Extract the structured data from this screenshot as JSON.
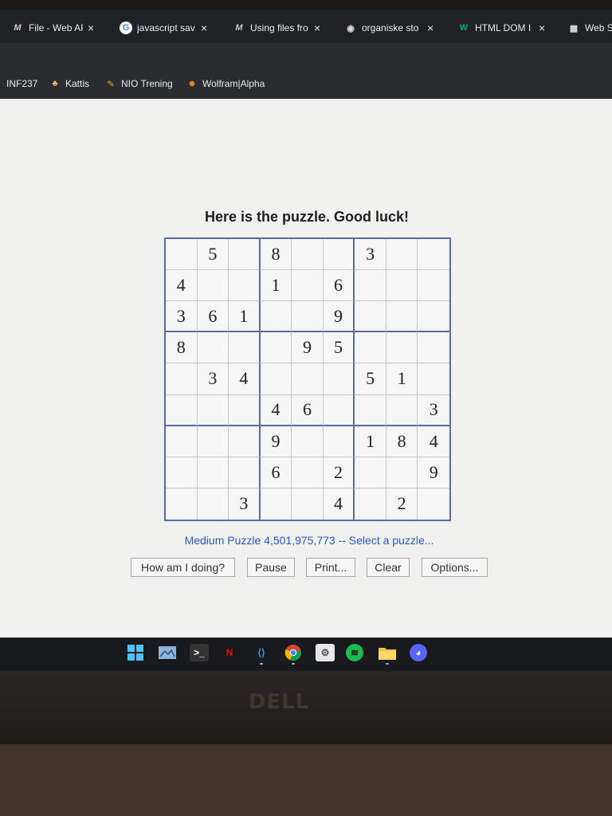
{
  "tabs": [
    {
      "icon": "mdn-m-icon",
      "glyph": "M",
      "title": "File - Web AP",
      "close": "×"
    },
    {
      "icon": "google-g-icon",
      "glyph": "G",
      "title": "javascript sav",
      "close": "×"
    },
    {
      "icon": "mdn-m-icon",
      "glyph": "M",
      "title": "Using files fro",
      "close": "×"
    },
    {
      "icon": "globe-icon",
      "glyph": "◉",
      "title": "organiske sto",
      "close": "×"
    },
    {
      "icon": "w3schools-icon",
      "glyph": "W",
      "title": "HTML DOM I",
      "close": "×"
    },
    {
      "icon": "grid-icon",
      "glyph": "▦",
      "title": "Web S",
      "close": ""
    }
  ],
  "bookmarks": [
    {
      "icon": "",
      "label": "INF237"
    },
    {
      "icon": "kattis-icon",
      "glyph": "♣",
      "label": "Kattis"
    },
    {
      "icon": "carrot-icon",
      "glyph": "✎",
      "label": "NIO Trening"
    },
    {
      "icon": "wolfram-icon",
      "glyph": "✹",
      "label": "Wolfram|Alpha"
    }
  ],
  "page": {
    "heading": "Here is the puzzle. Good luck!",
    "puzzle_name": "Medium Puzzle 4,501,975,773",
    "separator": " -- ",
    "select_link": "Select a puzzle...",
    "grid": [
      [
        "",
        "5",
        "",
        "8",
        "",
        "",
        "3",
        "",
        ""
      ],
      [
        "4",
        "",
        "",
        "1",
        "",
        "6",
        "",
        "",
        ""
      ],
      [
        "3",
        "6",
        "1",
        "",
        "",
        "9",
        "",
        "",
        ""
      ],
      [
        "8",
        "",
        "",
        "",
        "9",
        "5",
        "",
        "",
        ""
      ],
      [
        "",
        "3",
        "4",
        "",
        "",
        "",
        "5",
        "1",
        ""
      ],
      [
        "",
        "",
        "",
        "4",
        "6",
        "",
        "",
        "",
        "3"
      ],
      [
        "",
        "",
        "",
        "9",
        "",
        "",
        "1",
        "8",
        "4"
      ],
      [
        "",
        "",
        "",
        "6",
        "",
        "2",
        "",
        "",
        "9"
      ],
      [
        "",
        "",
        "3",
        "",
        "",
        "4",
        "",
        "2",
        ""
      ]
    ],
    "buttons": {
      "how": "How am I doing?",
      "pause": "Pause",
      "print": "Print...",
      "clear": "Clear",
      "options": "Options..."
    }
  },
  "taskbar": [
    {
      "icon": "windows-start-icon"
    },
    {
      "icon": "image-viewer-icon"
    },
    {
      "icon": "terminal-icon",
      "glyph": ">_"
    },
    {
      "icon": "netflix-icon",
      "glyph": "N"
    },
    {
      "icon": "vscode-icon",
      "glyph": "⟨⟩"
    },
    {
      "icon": "chrome-icon"
    },
    {
      "icon": "settings-gear-icon",
      "glyph": "⚙"
    },
    {
      "icon": "spotify-icon",
      "glyph": "≋"
    },
    {
      "icon": "file-explorer-icon"
    },
    {
      "icon": "discord-icon",
      "glyph": "◕"
    }
  ],
  "laptop_logo": "DELL",
  "colors": {
    "grid_border": "#5c6aa3",
    "link_blue": "#2b57c7",
    "browser_dark": "#202124"
  }
}
